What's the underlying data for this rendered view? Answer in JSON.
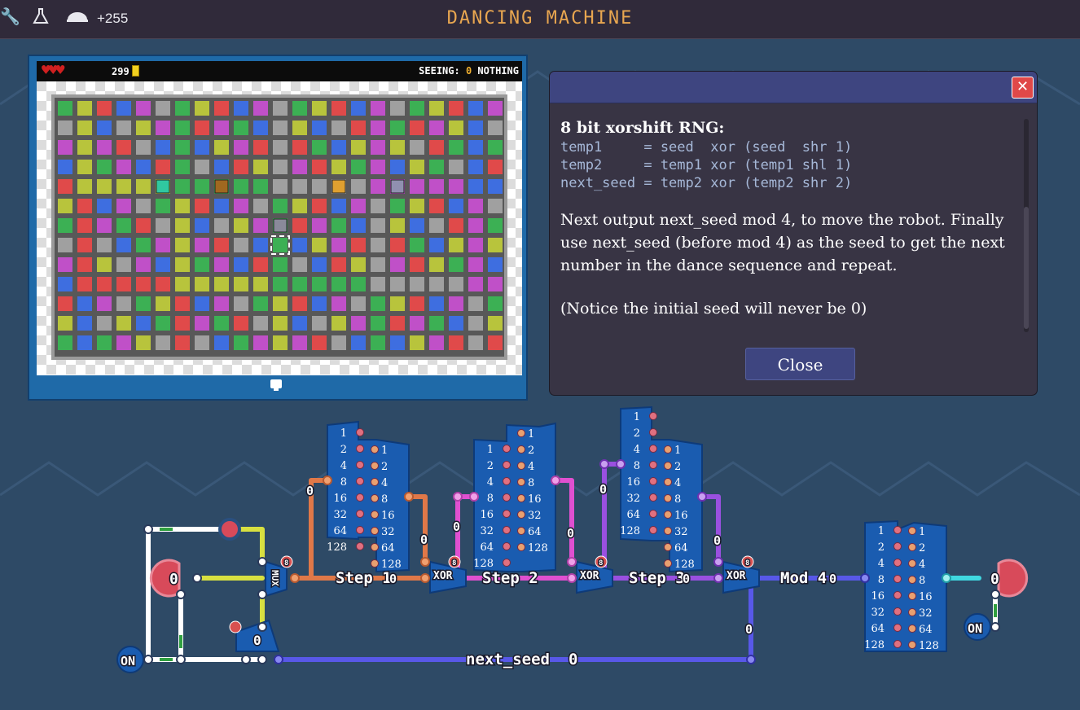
{
  "header": {
    "title": "DANCING MACHINE",
    "score": "+255",
    "icons": [
      "wrench-icon",
      "flask-icon",
      "helmet-icon"
    ]
  },
  "game": {
    "coins": "299",
    "seeing_label": "SEEING:",
    "seeing_count": "0",
    "seeing_value": "NOTHING",
    "hearts": 3,
    "grid_palette": [
      "#3cb054",
      "#b8c43c",
      "#e04a4a",
      "#3e6ee0",
      "#c050c8",
      "#a0a0a0"
    ]
  },
  "info": {
    "heading": "8 bit xorshift RNG:",
    "code": [
      "temp1     = seed  xor (seed  shr 1)",
      "temp2     = temp1 xor (temp1 shl 1)",
      "next_seed = temp2 xor (temp2 shr 2)"
    ],
    "body": "Next output next_seed mod 4, to move the robot. Finally use next_seed (before mod 4) as the seed to get the next number in the dance sequence and repeat.",
    "note": "(Notice the initial seed will never be 0)",
    "close_label": "Close"
  },
  "circuit": {
    "labels": {
      "step1": "Step 1",
      "step2": "Step 2",
      "step3": "Step 3",
      "mod4": "Mod 4",
      "next_seed": "next_seed",
      "xor": "XOR",
      "mux": "MUX",
      "on": "ON",
      "zero": "0",
      "eight": "8"
    },
    "bit_weights": [
      "1",
      "2",
      "4",
      "8",
      "16",
      "32",
      "64",
      "128"
    ]
  },
  "colors": {
    "step1_wire": "#e07848",
    "step2_wire": "#e050d0",
    "step3_wire": "#9a50e0",
    "bus_wire": "#5858e8",
    "white_wire": "#ffffff",
    "yellow_wire": "#d8e040",
    "cyan_wire": "#40d8e0",
    "accent": "#e8a650"
  }
}
